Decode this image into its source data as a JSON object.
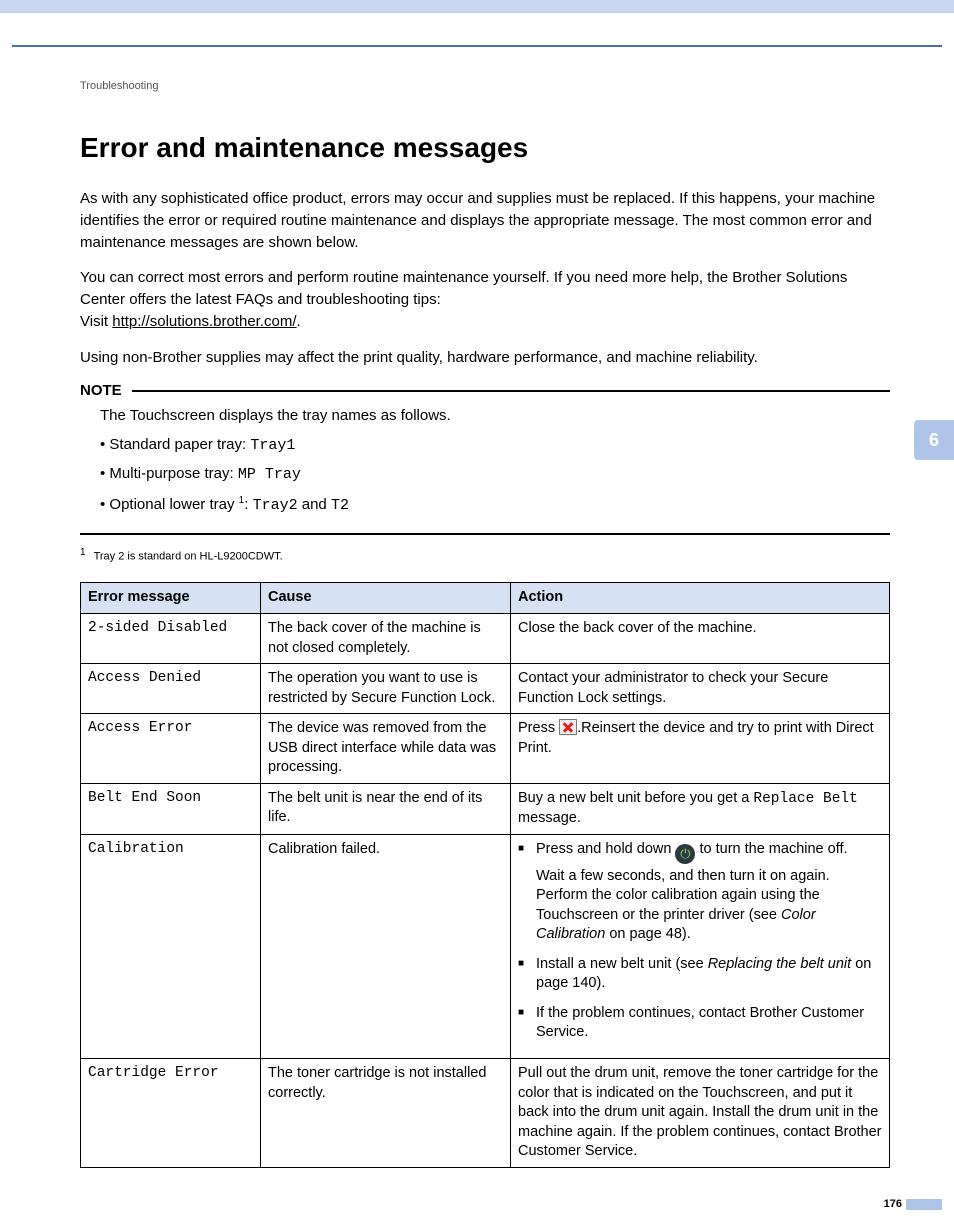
{
  "breadcrumb": "Troubleshooting",
  "chapter_tab": "6",
  "title": "Error and maintenance messages",
  "intro1": "As with any sophisticated office product, errors may occur and supplies must be replaced. If this happens, your machine identifies the error or required routine maintenance and displays the appropriate message. The most common error and maintenance messages are shown below.",
  "intro2_a": "You can correct most errors and perform routine maintenance yourself. If you need more help, the Brother Solutions Center offers the latest FAQs and troubleshooting tips:",
  "intro2_b_prefix": "Visit ",
  "intro2_b_link": "http://solutions.brother.com/",
  "intro2_b_suffix": ".",
  "intro3": "Using non-Brother supplies may affect the print quality, hardware performance, and machine reliability.",
  "note": {
    "label": "NOTE",
    "lead": "The Touchscreen displays the tray names as follows.",
    "items": [
      {
        "label": "Standard paper tray: ",
        "code": "Tray1",
        "sup": ""
      },
      {
        "label": "Multi-purpose tray: ",
        "code": "MP Tray",
        "sup": ""
      },
      {
        "label_pre": "Optional lower tray ",
        "sup": "1",
        "label_post": ": ",
        "code": "Tray2",
        "mid": " and ",
        "code2": "T2"
      }
    ]
  },
  "footnote_sup": "1",
  "footnote_text": "Tray 2 is standard on HL-L9200CDWT.",
  "table": {
    "headers": {
      "msg": "Error message",
      "cause": "Cause",
      "action": "Action"
    },
    "rows": [
      {
        "msg": "2-sided Disabled",
        "cause": "The back cover of the machine is not closed completely.",
        "action_plain": "Close the back cover of the machine."
      },
      {
        "msg": "Access Denied",
        "cause": "The operation you want to use is restricted by Secure Function Lock.",
        "action_plain": "Contact your administrator to check your Secure Function Lock settings."
      },
      {
        "msg": "Access Error",
        "cause": "The device was removed from the USB direct interface while data was processing.",
        "action_x": {
          "pre": "Press ",
          "post": ".Reinsert the device and try to print with Direct Print."
        }
      },
      {
        "msg": "Belt End Soon",
        "cause": "The belt unit is near the end of its life.",
        "action_belt": {
          "pre": "Buy a new belt unit before you get a ",
          "code": "Replace Belt",
          "post": " message."
        }
      },
      {
        "msg": "Calibration",
        "cause": "Calibration failed.",
        "action_list": [
          {
            "pre": "Press and hold down ",
            "icon": "power",
            "post": " to turn the machine off.",
            "sub": "Wait a few seconds, and then turn it on again. Perform the color calibration again using the Touchscreen or the printer driver (see ",
            "sub_italic": "Color Calibration",
            "sub_post": " on page 48)."
          },
          {
            "pre": "Install a new belt unit (see ",
            "italic": "Replacing the belt unit",
            "post": " on page 140)."
          },
          {
            "pre": "If the problem continues, contact Brother Customer Service."
          }
        ]
      },
      {
        "msg": "Cartridge Error",
        "cause": "The toner cartridge is not installed correctly.",
        "action_plain": "Pull out the drum unit, remove the toner cartridge for the color that is indicated on the Touchscreen, and put it back into the drum unit again. Install the drum unit in the machine again. If the problem continues, contact Brother Customer Service."
      }
    ]
  },
  "page_number": "176"
}
